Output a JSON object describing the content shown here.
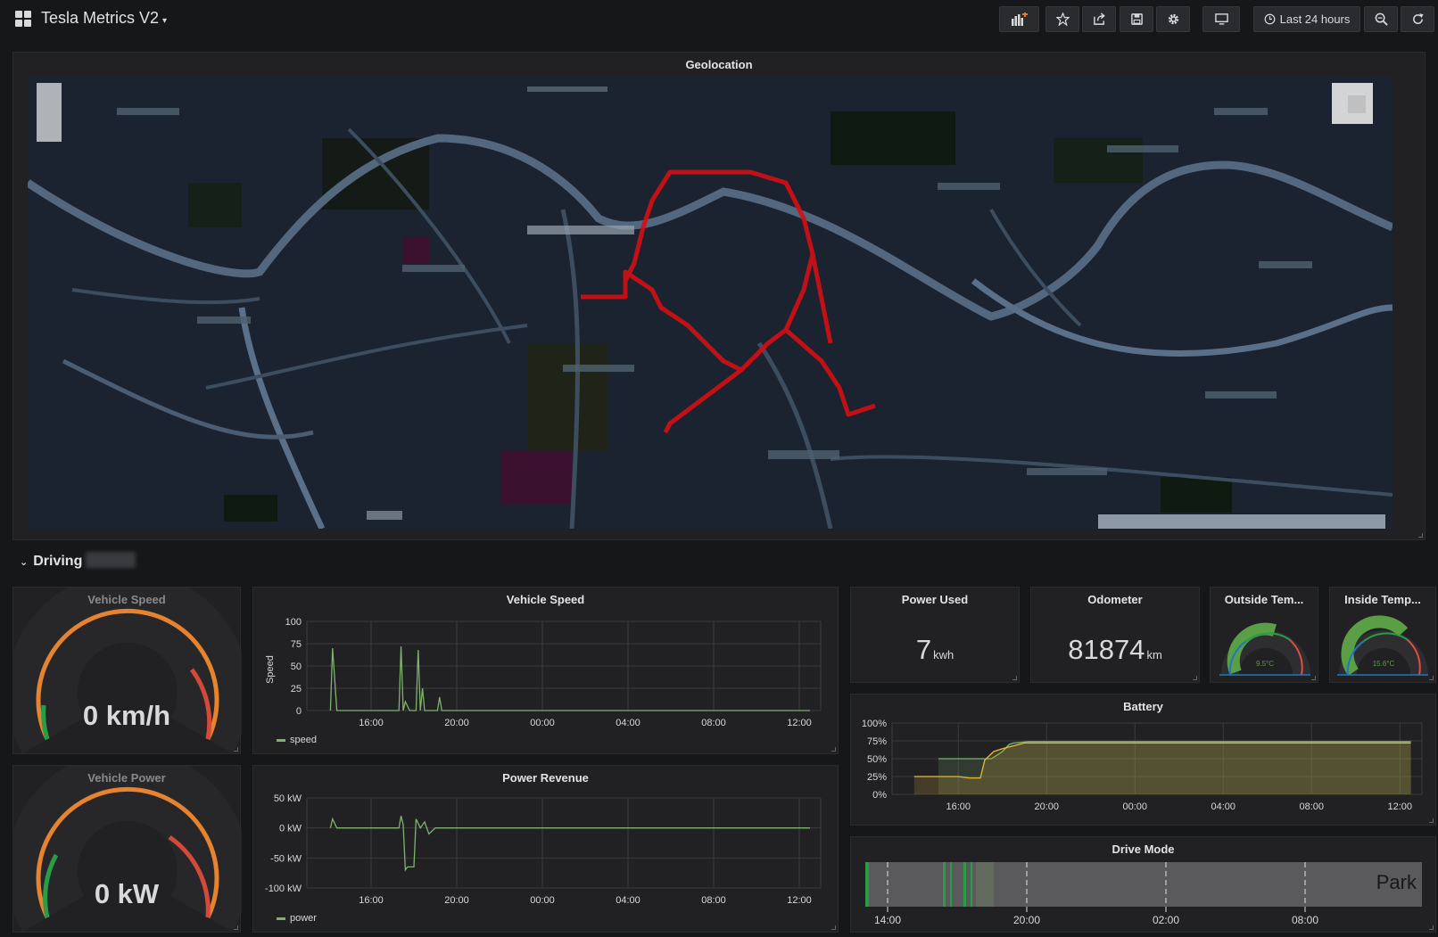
{
  "header": {
    "title": "Tesla Metrics V2",
    "time_range": "Last 24 hours"
  },
  "map": {
    "title": "Geolocation"
  },
  "row": {
    "title": "Driving"
  },
  "panels": {
    "speed_gauge": {
      "title": "Vehicle Speed",
      "value": "0 km/h",
      "level": 0
    },
    "power_gauge": {
      "title": "Vehicle Power",
      "value": "0 kW",
      "level": 0
    },
    "speed_graph": {
      "title": "Vehicle Speed",
      "ylabel": "Speed",
      "legend": "speed"
    },
    "power_graph": {
      "title": "Power Revenue",
      "legend": "power"
    },
    "power_used": {
      "title": "Power Used",
      "value": "7",
      "unit": "kwh"
    },
    "odometer": {
      "title": "Odometer",
      "value": "81874",
      "unit": "km"
    },
    "outside_temp": {
      "title": "Outside Tem...",
      "value": "9.5°C"
    },
    "inside_temp": {
      "title": "Inside Temp...",
      "value": "15.6°C"
    },
    "battery": {
      "title": "Battery"
    },
    "drive_mode": {
      "title": "Drive Mode",
      "current": "Park",
      "ticks": [
        "14:00",
        "20:00",
        "02:00",
        "08:00"
      ]
    }
  },
  "colors": {
    "series_green": "#7eb26d",
    "series_yellow": "#eab839",
    "gauge_orange": "#e5832f",
    "gauge_red": "#d44a3a",
    "gauge_green": "#299c46",
    "route_red": "#d40f14"
  },
  "chart_data": [
    {
      "type": "line",
      "title": "Vehicle Speed",
      "ylabel": "Speed",
      "x_ticks": [
        "16:00",
        "20:00",
        "00:00",
        "04:00",
        "08:00",
        "12:00"
      ],
      "ylim": [
        0,
        100
      ],
      "y_ticks": [
        0,
        25,
        50,
        75,
        100
      ],
      "series": [
        {
          "name": "speed",
          "x": [
            14.1,
            14.2,
            14.4,
            17.3,
            17.4,
            17.5,
            17.6,
            17.8,
            18.1,
            18.2,
            18.3,
            18.4,
            18.5,
            18.6,
            19.1,
            19.2,
            19.3,
            12.5
          ],
          "values": [
            0,
            70,
            0,
            0,
            72,
            0,
            10,
            0,
            0,
            68,
            0,
            25,
            0,
            0,
            0,
            15,
            0,
            0
          ]
        }
      ],
      "grid": true
    },
    {
      "type": "line",
      "title": "Power Revenue",
      "x_ticks": [
        "16:00",
        "20:00",
        "00:00",
        "04:00",
        "08:00",
        "12:00"
      ],
      "y_ticks": [
        "50 kW",
        "0 kW",
        "-50 kW",
        "-100 kW"
      ],
      "ylim": [
        -100,
        50
      ],
      "series": [
        {
          "name": "power",
          "x": [
            14.1,
            14.2,
            14.4,
            17.3,
            17.4,
            17.5,
            17.6,
            17.7,
            18.0,
            18.1,
            18.3,
            18.5,
            18.7,
            19.0,
            12.5
          ],
          "values": [
            0,
            15,
            0,
            0,
            20,
            5,
            -70,
            -65,
            -65,
            15,
            0,
            10,
            -10,
            0,
            0
          ]
        }
      ],
      "grid": true
    },
    {
      "type": "area",
      "title": "Battery",
      "x_ticks": [
        "16:00",
        "20:00",
        "00:00",
        "04:00",
        "08:00",
        "12:00"
      ],
      "y_ticks": [
        "0%",
        "25%",
        "50%",
        "75%",
        "100%"
      ],
      "ylim": [
        0,
        100
      ],
      "series": [
        {
          "x": [
            15.1,
            16.0,
            17.5,
            18.0,
            18.3,
            18.5,
            19.2,
            12.5
          ],
          "values": [
            50,
            50,
            50,
            60,
            70,
            72,
            74,
            74
          ]
        },
        {
          "x": [
            14.0,
            16.0,
            16.5,
            17.0,
            17.2,
            17.6,
            18.0,
            19.0,
            12.5
          ],
          "values": [
            25,
            25,
            23,
            23,
            48,
            60,
            64,
            72,
            72
          ]
        }
      ],
      "grid": true
    }
  ]
}
